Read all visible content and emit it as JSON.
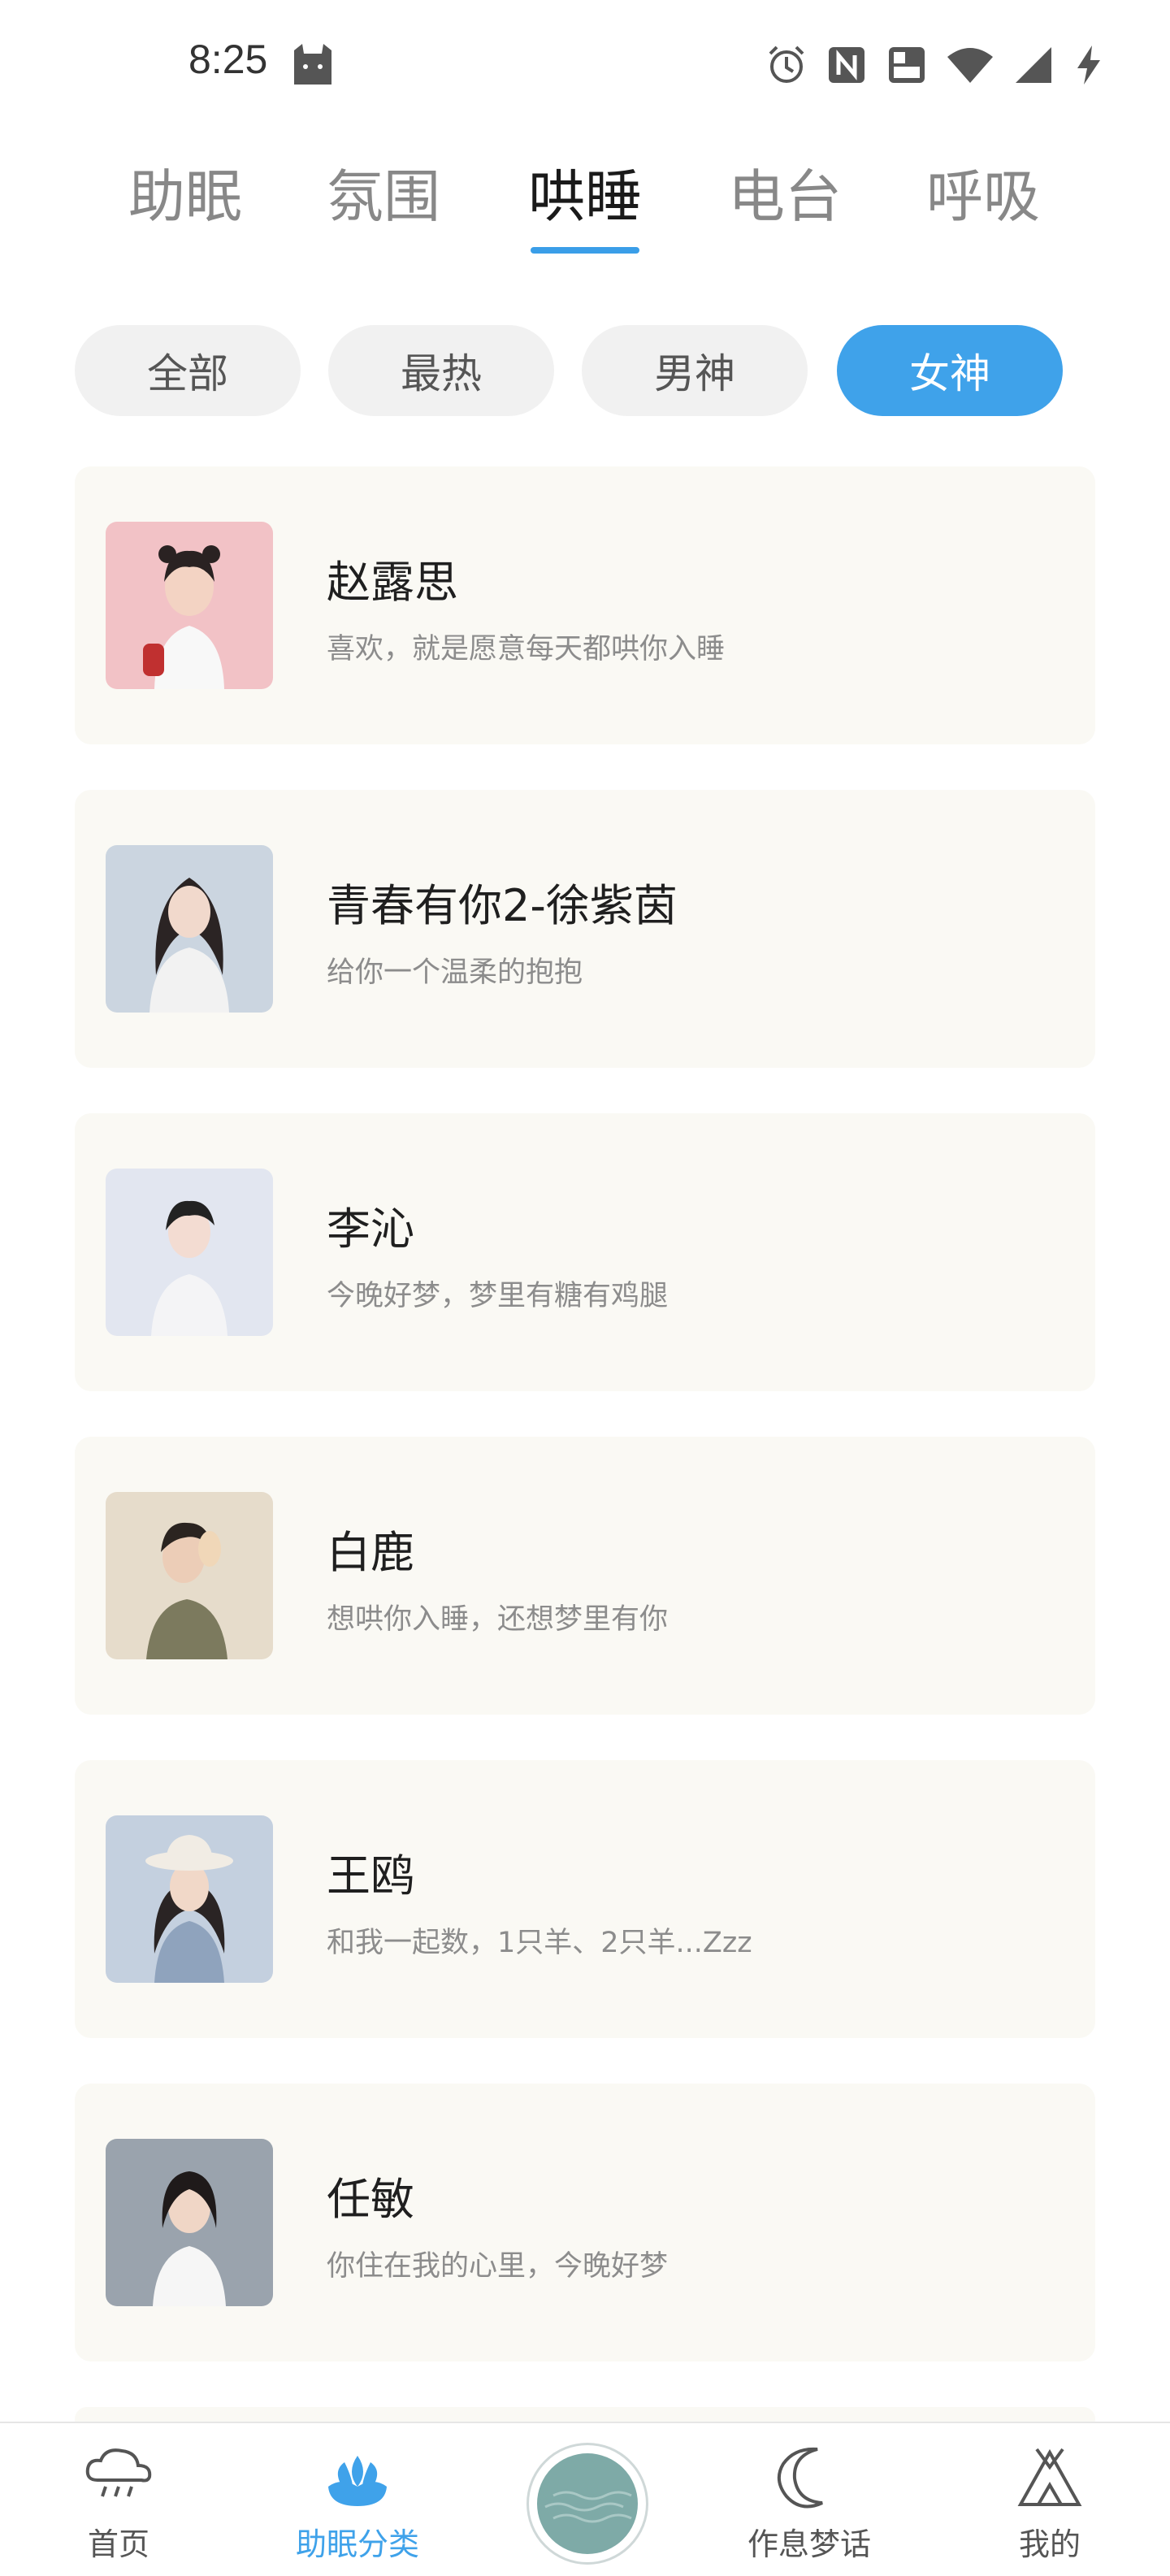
{
  "status_bar": {
    "time": "8:25"
  },
  "top_tabs": [
    {
      "label": "助眠"
    },
    {
      "label": "氛围"
    },
    {
      "label": "哄睡"
    },
    {
      "label": "电台"
    },
    {
      "label": "呼吸"
    }
  ],
  "active_top_tab": "哄睡",
  "filters": [
    {
      "label": "全部"
    },
    {
      "label": "最热"
    },
    {
      "label": "男神"
    },
    {
      "label": "女神"
    }
  ],
  "active_filter": "女神",
  "cards": [
    {
      "title": "赵露思",
      "subtitle": "喜欢，就是愿意每天都哄你入睡"
    },
    {
      "title": "青春有你2-徐紫茵",
      "subtitle": "给你一个温柔的抱抱"
    },
    {
      "title": "李沁",
      "subtitle": "今晚好梦，梦里有糖有鸡腿"
    },
    {
      "title": "白鹿",
      "subtitle": "想哄你入睡，还想梦里有你"
    },
    {
      "title": "王鸥",
      "subtitle": "和我一起数，1只羊、2只羊...Zzz"
    },
    {
      "title": "任敏",
      "subtitle": "你住在我的心里，今晚好梦"
    }
  ],
  "bottom_nav": [
    {
      "label": "首页",
      "icon": "cloud-rain-icon"
    },
    {
      "label": "助眠分类",
      "icon": "lotus-icon"
    },
    {
      "label": "",
      "icon": "waves-icon"
    },
    {
      "label": "作息梦话",
      "icon": "moon-icon"
    },
    {
      "label": "我的",
      "icon": "tent-icon"
    }
  ],
  "colors": {
    "accent": "#3fa2ea",
    "card_bg": "#faf9f4",
    "chip_bg": "#f1f1f1"
  }
}
